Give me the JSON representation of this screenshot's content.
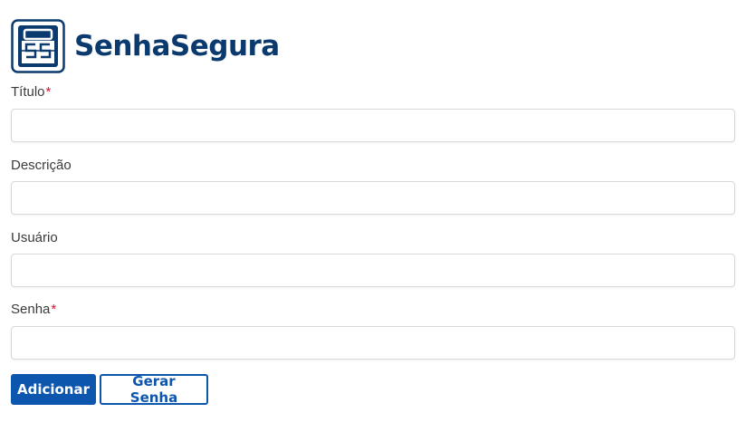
{
  "header": {
    "brand_name": "SenhaSegura",
    "logo_icon": "password-safe-icon",
    "brand_color": "#0b3a6f"
  },
  "form": {
    "fields": [
      {
        "label": "Título",
        "required": true,
        "value": ""
      },
      {
        "label": "Descrição",
        "required": false,
        "value": ""
      },
      {
        "label": "Usuário",
        "required": false,
        "value": ""
      },
      {
        "label": "Senha",
        "required": true,
        "value": ""
      }
    ],
    "required_marker": "*",
    "required_color": "#d9122b"
  },
  "actions": {
    "add_label": "Adicionar",
    "generate_label": "Gerar Senha",
    "accent_color": "#0d56ad"
  }
}
